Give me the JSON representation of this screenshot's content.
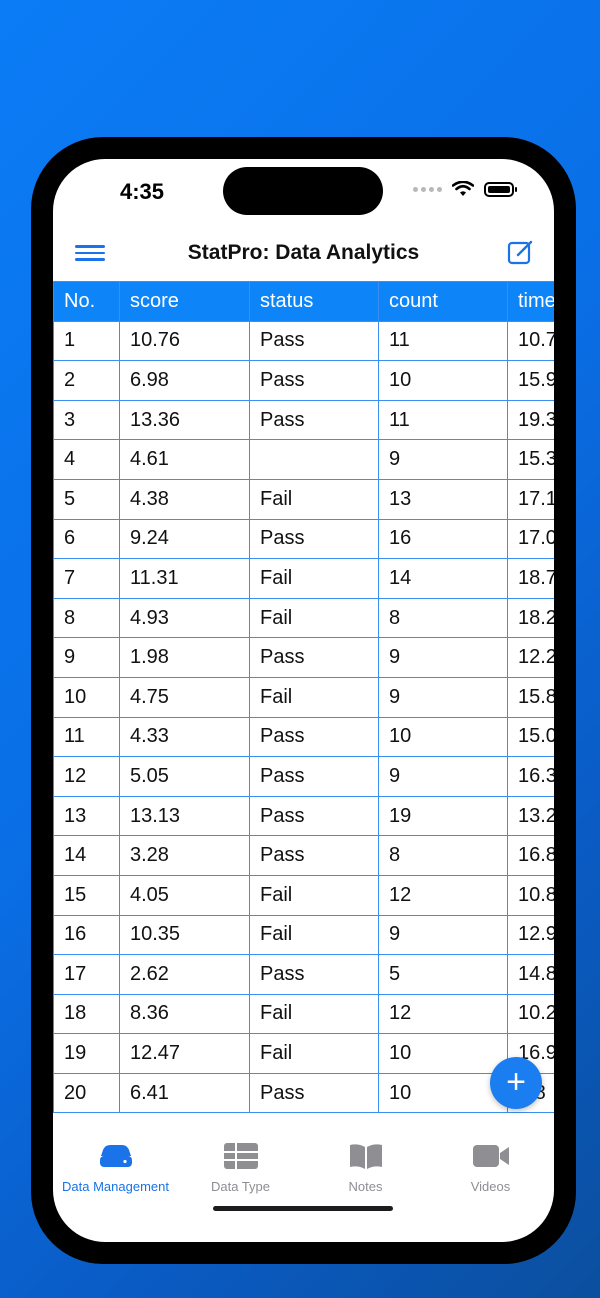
{
  "status_bar": {
    "time": "4:35"
  },
  "nav": {
    "title": "StatPro: Data Analytics",
    "menu_icon": "hamburger-icon",
    "edit_icon": "edit-square-icon"
  },
  "table": {
    "headers": [
      "No.",
      "score",
      "status",
      "count",
      "time"
    ],
    "rows": [
      [
        "1",
        "10.76",
        "Pass",
        "11",
        "10.7"
      ],
      [
        "2",
        "6.98",
        "Pass",
        "10",
        "15.9"
      ],
      [
        "3",
        "13.36",
        "Pass",
        "11",
        "19.3"
      ],
      [
        "4",
        "4.61",
        "",
        "9",
        "15.3"
      ],
      [
        "5",
        "4.38",
        "Fail",
        "13",
        "17.1"
      ],
      [
        "6",
        "9.24",
        "Pass",
        "16",
        "17.0"
      ],
      [
        "7",
        "11.31",
        "Fail",
        "14",
        "18.7"
      ],
      [
        "8",
        "4.93",
        "Fail",
        "8",
        "18.2"
      ],
      [
        "9",
        "1.98",
        "Pass",
        "9",
        "12.2"
      ],
      [
        "10",
        "4.75",
        "Fail",
        "9",
        "15.8"
      ],
      [
        "11",
        "4.33",
        "Pass",
        "10",
        "15.0"
      ],
      [
        "12",
        "5.05",
        "Pass",
        "9",
        "16.3"
      ],
      [
        "13",
        "13.13",
        "Pass",
        "19",
        "13.2"
      ],
      [
        "14",
        "3.28",
        "Pass",
        "8",
        "16.8"
      ],
      [
        "15",
        "4.05",
        "Fail",
        "12",
        "10.8"
      ],
      [
        "16",
        "10.35",
        "Fail",
        "9",
        "12.9"
      ],
      [
        "17",
        "2.62",
        "Pass",
        "5",
        "14.8"
      ],
      [
        "18",
        "8.36",
        "Fail",
        "12",
        "10.2"
      ],
      [
        "19",
        "12.47",
        "Fail",
        "10",
        "16.9"
      ],
      [
        "20",
        "6.41",
        "Pass",
        "10",
        "5.8"
      ]
    ]
  },
  "fab": {
    "label": "+"
  },
  "tabbar": {
    "items": [
      {
        "label": "Data Management",
        "icon": "drive-icon",
        "active": true
      },
      {
        "label": "Data Type",
        "icon": "table-icon",
        "active": false
      },
      {
        "label": "Notes",
        "icon": "book-icon",
        "active": false
      },
      {
        "label": "Videos",
        "icon": "video-camera-icon",
        "active": false
      }
    ]
  },
  "colors": {
    "accent": "#0d84f8",
    "inactive": "#8e8e93",
    "grid": "#3b8ff0"
  }
}
